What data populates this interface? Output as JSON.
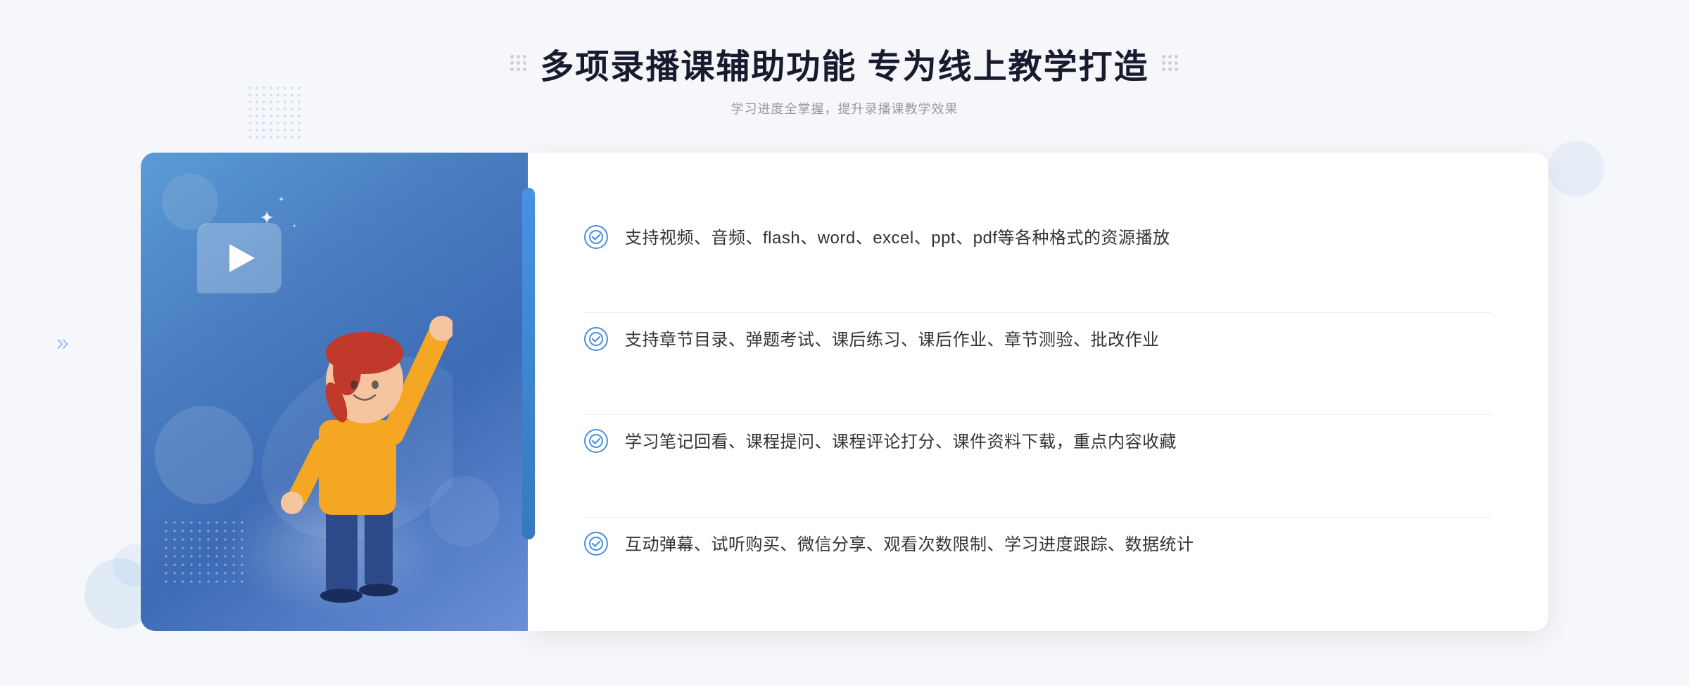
{
  "header": {
    "title": "多项录播课辅助功能 专为线上教学打造",
    "subtitle": "学习进度全掌握，提升录播课教学效果"
  },
  "features": [
    {
      "id": "feature-1",
      "text": "支持视频、音频、flash、word、excel、ppt、pdf等各种格式的资源播放"
    },
    {
      "id": "feature-2",
      "text": "支持章节目录、弹题考试、课后练习、课后作业、章节测验、批改作业"
    },
    {
      "id": "feature-3",
      "text": "学习笔记回看、课程提问、课程评论打分、课件资料下载，重点内容收藏"
    },
    {
      "id": "feature-4",
      "text": "互动弹幕、试听购买、微信分享、观看次数限制、学习进度跟踪、数据统计"
    }
  ],
  "colors": {
    "primary": "#4a90e2",
    "accent": "#357abd",
    "text_dark": "#1a1a2e",
    "text_light": "#999999",
    "text_body": "#333333"
  },
  "icons": {
    "check": "✓",
    "play": "▶",
    "arrows_left": "»",
    "dots_deco": "⋮⋮"
  }
}
